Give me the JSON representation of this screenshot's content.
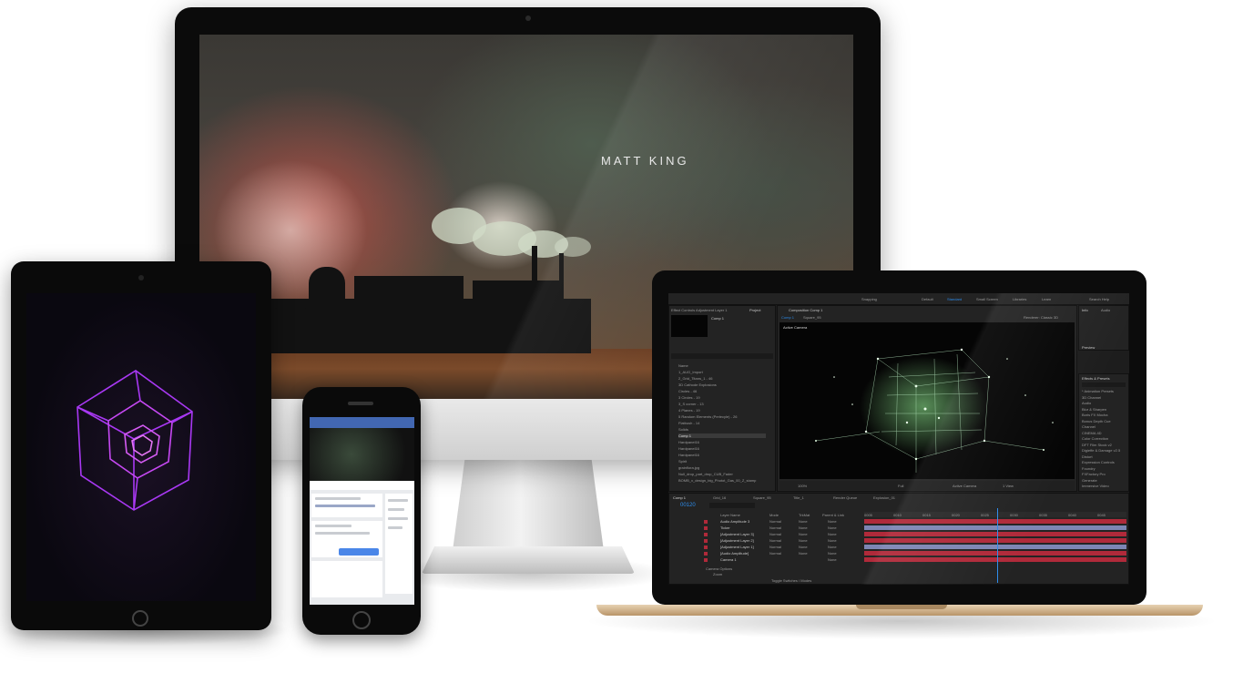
{
  "desktop": {
    "hero_title": "MATT KING"
  },
  "tablet": {
    "graphic": "wireframe-cube"
  },
  "phone": {
    "app": "social-profile-page"
  },
  "laptop": {
    "app": "motion-graphics-editor",
    "toolbar": {
      "workspaces": [
        "Default",
        "Standard",
        "Small Screen",
        "Libraries",
        "Learn"
      ],
      "search_label": "Search Help",
      "snapping_label": "Snapping"
    },
    "project_panel": {
      "tab_label": "Project",
      "effect_controls_label": "Effect Controls Adjustment Layer 1",
      "comp_name": "Comp 1",
      "name_column": "Name",
      "items": [
        "1_AUG_Import",
        "2_Grid_Titans_1 - 46",
        "3D Cathode Explosions",
        "Circles - 46",
        "3 Circles - 19",
        "3_S corner - 13",
        "4 Planes - 19",
        "5 Random Elements (Perlecyle) - 26",
        "Flatbush - 14",
        "Solids",
        "Comp 1",
        "Hardpanel16",
        "Hardpanel16",
        "Hardpanel16",
        "Spirit",
        "grainflora.jpg",
        "Null_drop_part_drop_CUB_Fader",
        "BOMB_x_design_big_Photot_Gas_00_Z_stamp"
      ]
    },
    "composition": {
      "tab_label": "Composition Comp 1",
      "sub_tabs": [
        "Comp 1",
        "Square_95"
      ],
      "active_camera": "Active Camera",
      "renderer": "Renderer: Classic 3D",
      "zoom": "100%",
      "quality": "Full",
      "view": "1 View"
    },
    "effects_panel": {
      "info_label": "Info",
      "audio_label": "Audio",
      "preview_label": "Preview",
      "title": "Effects & Presets",
      "items": [
        "* Animation Presets",
        "3D Channel",
        "Audio",
        "Blur & Sharpen",
        "Boris FX Mocha",
        "Bonus Depth Cue",
        "Channel",
        "CINEMA 4D",
        "Color Correction",
        "DFT Film Stock v2",
        "Digieffe & Damage v2.5",
        "Distort",
        "Expression Controls",
        "Foundry",
        "FXFactory Pro",
        "Generate",
        "Immersive Video"
      ]
    },
    "timeline": {
      "tabs": [
        "Comp 1",
        "Grid_16",
        "Square_95",
        "Title_1",
        "Render Queue",
        "Explosion_01"
      ],
      "timecode": "00120",
      "layer_header": "Layer Name",
      "mode_header": "Mode",
      "trkmat_header": "TrkMat",
      "parent_header": "Parent & Link",
      "layers": [
        {
          "name": "Audio Amplitude 3",
          "mode": "Normal",
          "trkmat": "None",
          "parent": "None"
        },
        {
          "name": "Ticker",
          "mode": "Normal",
          "trkmat": "None",
          "parent": "None"
        },
        {
          "name": "[Adjustment Layer 3]",
          "mode": "Normal",
          "trkmat": "None",
          "parent": "None"
        },
        {
          "name": "[Adjustment Layer 2]",
          "mode": "Normal",
          "trkmat": "None",
          "parent": "None"
        },
        {
          "name": "[Adjustment Layer 1]",
          "mode": "Normal",
          "trkmat": "None",
          "parent": "None"
        },
        {
          "name": "[Audio Amplitude]",
          "mode": "Normal",
          "trkmat": "None",
          "parent": "None"
        },
        {
          "name": "Camera 1",
          "mode": "",
          "trkmat": "",
          "parent": "None"
        }
      ],
      "camera_options": "Camera Options",
      "zoom_label": "Zoom",
      "toggle_label": "Toggle Switches / Modes",
      "ruler": [
        "0005",
        "0010",
        "0015",
        "0020",
        "0025",
        "0030",
        "0035",
        "0040",
        "0045"
      ]
    },
    "colors": {
      "accent_blue": "#2d8ceb",
      "track_red": "#b02a3a",
      "track_blue": "#7d86b4"
    }
  }
}
